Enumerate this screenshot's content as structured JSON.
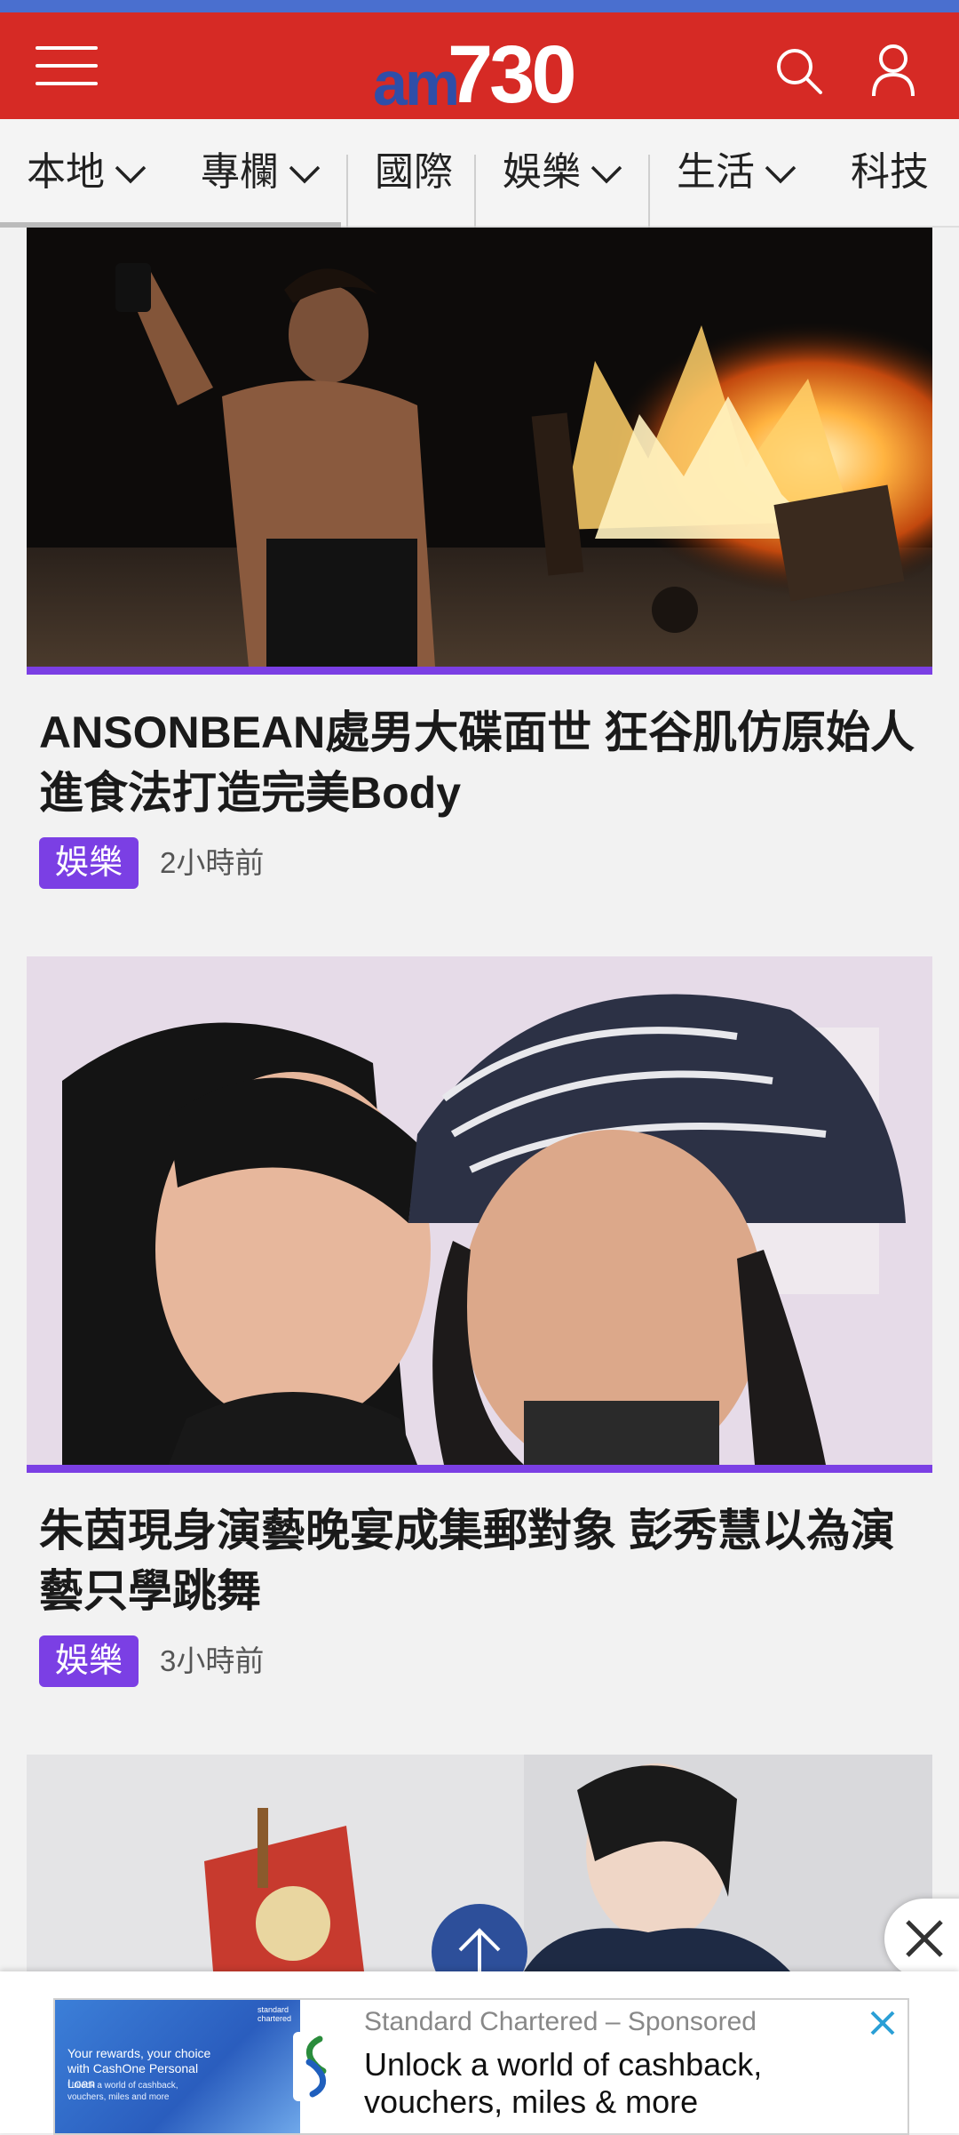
{
  "header": {
    "logo_am": "am",
    "logo_num": "730",
    "accent_color": "#d62a25",
    "icons": [
      "menu-icon",
      "search-icon",
      "user-icon"
    ]
  },
  "nav": {
    "items": [
      {
        "label": "本地",
        "dropdown": true
      },
      {
        "label": "專欄",
        "dropdown": true
      },
      {
        "label": "國際",
        "dropdown": false
      },
      {
        "label": "娛樂",
        "dropdown": true
      },
      {
        "label": "生活",
        "dropdown": true
      },
      {
        "label": "科技",
        "dropdown": false
      }
    ]
  },
  "articles": [
    {
      "headline": "ANSONBEAN處男大碟面世 狂谷肌仿原始人進食法打造完美Body",
      "tag": "娛樂",
      "time": "2小時前"
    },
    {
      "headline": "朱茵現身演藝晚宴成集郵對象 彭秀慧以為演藝只學跳舞",
      "tag": "娛樂",
      "time": "3小時前"
    }
  ],
  "tag_color": "#7b3fe4",
  "ad": {
    "sponsor_name": "Standard Chartered",
    "sponsor_sep": " – ",
    "sponsor_label": "Sponsored",
    "title": "Unlock a world of cashback, vouchers, miles & more",
    "thumb_text_1": "Your rewards, your choice with CashOne Personal Loan",
    "thumb_text_2": "Unlock a world of cashback, vouchers, miles and more",
    "thumb_brand": "standard chartered"
  }
}
